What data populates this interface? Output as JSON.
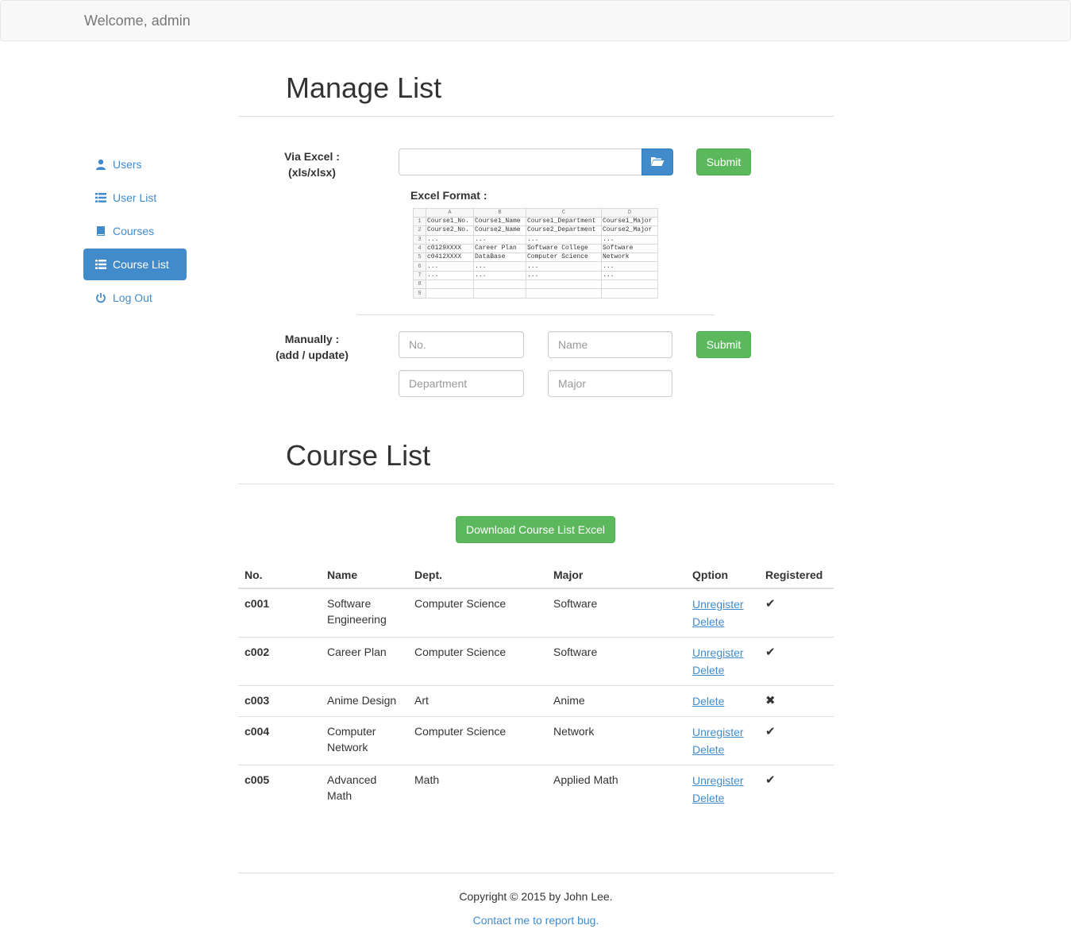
{
  "navbar": {
    "brand": "Welcome, admin"
  },
  "sidebar": {
    "items": [
      {
        "label": "Users",
        "icon": "user-icon"
      },
      {
        "label": "User List",
        "icon": "list-icon"
      },
      {
        "label": "Courses",
        "icon": "book-icon"
      },
      {
        "label": "Course List",
        "icon": "list-icon",
        "active": true
      },
      {
        "label": "Log Out",
        "icon": "power-icon"
      }
    ]
  },
  "manage": {
    "title": "Manage List",
    "excel": {
      "label_line1": "Via Excel :",
      "label_line2": "(xls/xlsx)",
      "submit": "Submit",
      "format_label": "Excel Format :",
      "sheet": {
        "columns": [
          "A",
          "B",
          "C",
          "D"
        ],
        "rows": [
          [
            "1",
            "Course1_No.",
            "Course1_Name",
            "Course1_Department",
            "Course1_Major"
          ],
          [
            "2",
            "Course2_No.",
            "Course2_Name",
            "Course2_Department",
            "Course2_Major"
          ],
          [
            "3",
            "...",
            "...",
            "...",
            "..."
          ],
          [
            "4",
            "c0129XXXX",
            "Career Plan",
            "Software College",
            "Software"
          ],
          [
            "5",
            "c0412XXXX",
            "DataBase",
            "Computer Science",
            "Network"
          ],
          [
            "6",
            "...",
            "...",
            "...",
            "..."
          ],
          [
            "7",
            "...",
            "...",
            "...",
            "..."
          ],
          [
            "8",
            "",
            "",
            "",
            ""
          ],
          [
            "9",
            "",
            "",
            "",
            ""
          ]
        ]
      }
    },
    "manual": {
      "label_line1": "Manually :",
      "label_line2": "(add / update)",
      "placeholders": {
        "no": "No.",
        "name": "Name",
        "department": "Department",
        "major": "Major"
      },
      "submit": "Submit"
    }
  },
  "course_list": {
    "title": "Course List",
    "download_button": "Download Course List Excel",
    "columns": [
      "No.",
      "Name",
      "Dept.",
      "Major",
      "Qption",
      "Registered"
    ],
    "rows": [
      {
        "no": "c001",
        "name": "Software Engineering",
        "dept": "Computer Science",
        "major": "Software",
        "options": [
          "Unregister",
          "Delete"
        ],
        "registered": true
      },
      {
        "no": "c002",
        "name": "Career Plan",
        "dept": "Computer Science",
        "major": "Software",
        "options": [
          "Unregister",
          "Delete"
        ],
        "registered": true
      },
      {
        "no": "c003",
        "name": "Anime Design",
        "dept": "Art",
        "major": "Anime",
        "options": [
          "Delete"
        ],
        "registered": false
      },
      {
        "no": "c004",
        "name": "Computer Network",
        "dept": "Computer Science",
        "major": "Network",
        "options": [
          "Unregister",
          "Delete"
        ],
        "registered": true
      },
      {
        "no": "c005",
        "name": "Advanced Math",
        "dept": "Math",
        "major": "Applied Math",
        "options": [
          "Unregister",
          "Delete"
        ],
        "registered": true
      }
    ]
  },
  "footer": {
    "copyright": "Copyright © 2015 by John Lee.",
    "contact": "Contact me to report bug."
  },
  "colors": {
    "primary": "#428bca",
    "success": "#5cb85c",
    "navbar_bg": "#f8f8f8"
  }
}
